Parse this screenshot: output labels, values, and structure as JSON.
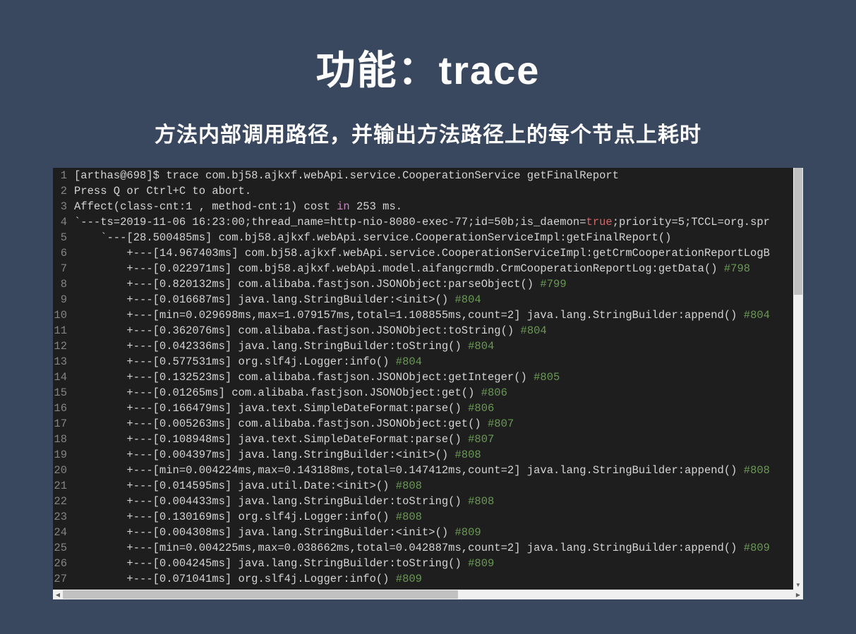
{
  "title": "功能：trace",
  "subtitle": "方法内部调用路径，并输出方法路径上的每个节点上耗时",
  "code_lines": [
    {
      "n": "1",
      "t": "[arthas@698]$ trace com.bj58.ajkxf.webApi.service.CooperationService getFinalReport"
    },
    {
      "n": "2",
      "t": "Press Q or Ctrl+C to abort."
    },
    {
      "n": "3",
      "pre": "Affect(class-cnt:1 , method-cnt:1) cost ",
      "kw": "in",
      "post": " 253 ms."
    },
    {
      "n": "4",
      "pre": "`---ts=2019-11-06 16:23:00;thread_name=http-nio-8080-exec-77;id=50b;is_daemon=",
      "kw": "true",
      "post": ";priority=5;TCCL=org.spr"
    },
    {
      "n": "5",
      "t": "    `---[28.500485ms] com.bj58.ajkxf.webApi.service.CooperationServiceImpl:getFinalReport()"
    },
    {
      "n": "6",
      "t": "        +---[14.967403ms] com.bj58.ajkxf.webApi.service.CooperationServiceImpl:getCrmCooperationReportLogB"
    },
    {
      "n": "7",
      "t": "        +---[0.022971ms] com.bj58.ajkxf.webApi.model.aifangcrmdb.CrmCooperationReportLog:getData() ",
      "c": "#798"
    },
    {
      "n": "8",
      "t": "        +---[0.820132ms] com.alibaba.fastjson.JSONObject:parseObject() ",
      "c": "#799"
    },
    {
      "n": "9",
      "t": "        +---[0.016687ms] java.lang.StringBuilder:<init>() ",
      "c": "#804"
    },
    {
      "n": "10",
      "t": "        +---[min=0.029698ms,max=1.079157ms,total=1.108855ms,count=2] java.lang.StringBuilder:append() ",
      "c": "#804"
    },
    {
      "n": "11",
      "t": "        +---[0.362076ms] com.alibaba.fastjson.JSONObject:toString() ",
      "c": "#804"
    },
    {
      "n": "12",
      "t": "        +---[0.042336ms] java.lang.StringBuilder:toString() ",
      "c": "#804"
    },
    {
      "n": "13",
      "t": "        +---[0.577531ms] org.slf4j.Logger:info() ",
      "c": "#804"
    },
    {
      "n": "14",
      "t": "        +---[0.132523ms] com.alibaba.fastjson.JSONObject:getInteger() ",
      "c": "#805"
    },
    {
      "n": "15",
      "t": "        +---[0.01265ms] com.alibaba.fastjson.JSONObject:get() ",
      "c": "#806"
    },
    {
      "n": "16",
      "t": "        +---[0.166479ms] java.text.SimpleDateFormat:parse() ",
      "c": "#806"
    },
    {
      "n": "17",
      "t": "        +---[0.005263ms] com.alibaba.fastjson.JSONObject:get() ",
      "c": "#807"
    },
    {
      "n": "18",
      "t": "        +---[0.108948ms] java.text.SimpleDateFormat:parse() ",
      "c": "#807"
    },
    {
      "n": "19",
      "t": "        +---[0.004397ms] java.lang.StringBuilder:<init>() ",
      "c": "#808"
    },
    {
      "n": "20",
      "t": "        +---[min=0.004224ms,max=0.143188ms,total=0.147412ms,count=2] java.lang.StringBuilder:append() ",
      "c": "#808"
    },
    {
      "n": "21",
      "t": "        +---[0.014595ms] java.util.Date:<init>() ",
      "c": "#808"
    },
    {
      "n": "22",
      "t": "        +---[0.004433ms] java.lang.StringBuilder:toString() ",
      "c": "#808"
    },
    {
      "n": "23",
      "t": "        +---[0.130169ms] org.slf4j.Logger:info() ",
      "c": "#808"
    },
    {
      "n": "24",
      "t": "        +---[0.004308ms] java.lang.StringBuilder:<init>() ",
      "c": "#809"
    },
    {
      "n": "25",
      "t": "        +---[min=0.004225ms,max=0.038662ms,total=0.042887ms,count=2] java.lang.StringBuilder:append() ",
      "c": "#809"
    },
    {
      "n": "26",
      "t": "        +---[0.004245ms] java.lang.StringBuilder:toString() ",
      "c": "#809"
    },
    {
      "n": "27",
      "t": "        +---[0.071041ms] org.slf4j.Logger:info() ",
      "c": "#809"
    }
  ]
}
